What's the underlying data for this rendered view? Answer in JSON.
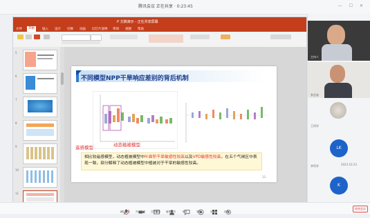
{
  "meeting": {
    "title": "腾讯会议 正在共享 · 0:23:45",
    "topbar_icons": "— ☐ ✕"
  },
  "ppt": {
    "window_title": "P 文稿演示 - 正在共享屏幕",
    "tabs": [
      "文件",
      "开始",
      "插入",
      "设计",
      "切换",
      "动画",
      "幻灯片放映",
      "审阅",
      "视图",
      "帮助"
    ],
    "active_tab": "开始"
  },
  "thumbs": {
    "numbers": [
      "5",
      "6",
      "7",
      "8",
      "9",
      "10",
      "11",
      "12"
    ]
  },
  "slide": {
    "title": "不同模型NPP干旱响应差别的背后机制",
    "label_remote": "遥感模型",
    "label_dynamic": "动态植被模型",
    "caption_pre": "相比较遥感模型，动态植被模型中",
    "caption_hl1": "叶面积干旱敏感性较高",
    "caption_mid": "以及",
    "caption_hl2": "VPD敏感性较高",
    "caption_post": "，在五个气候区中表现一致，部分解释了动态植被模型中植被对于干旱的敏感性较高。",
    "page_number": "13"
  },
  "bottombar": {
    "items": [
      "解除静音",
      "开启视频",
      "共享屏幕",
      "管理成员",
      "聊天",
      "录制",
      "应用",
      "设置"
    ],
    "leave_label": "结束会议"
  },
  "participants": [
    {
      "type": "video",
      "name": "主持人"
    },
    {
      "type": "video",
      "name": "参会者"
    },
    {
      "type": "photo",
      "name": "王同学"
    },
    {
      "type": "avatar",
      "initials": "LK",
      "name": "李同学"
    },
    {
      "type": "avatar",
      "initials": "K",
      "name": "2023.10.23"
    }
  ],
  "colors": {
    "ppt_red": "#c43e1c",
    "title_blue": "#1a3d8f",
    "label_red": "#e03030",
    "avatar_blue": "#1e63c9"
  }
}
